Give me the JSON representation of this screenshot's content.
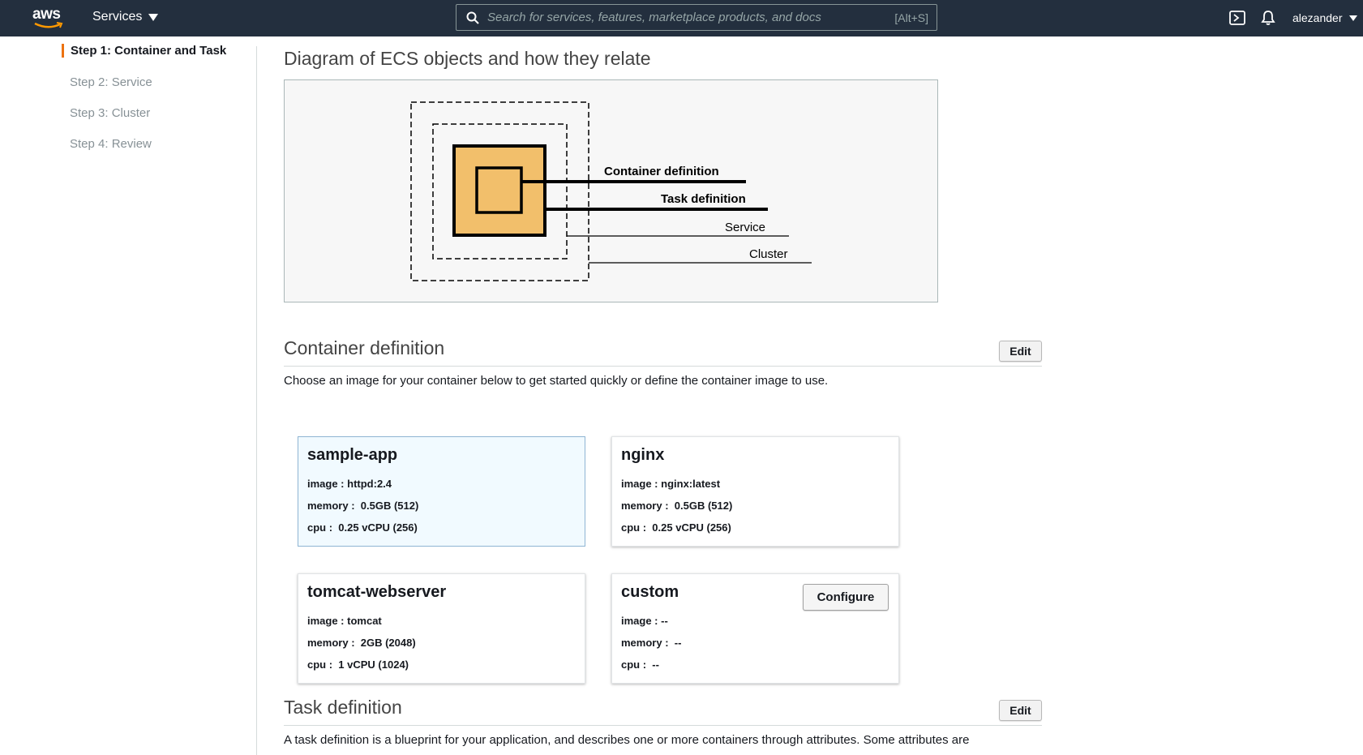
{
  "topnav": {
    "logo_text": "aws",
    "services_label": "Services",
    "search_placeholder": "Search for services, features, marketplace products, and docs",
    "search_shortcut": "[Alt+S]",
    "username": "alezander"
  },
  "steps": [
    {
      "label": "Step 1: Container and Task",
      "active": true
    },
    {
      "label": "Step 2: Service",
      "active": false
    },
    {
      "label": "Step 3: Cluster",
      "active": false
    },
    {
      "label": "Step 4: Review",
      "active": false
    }
  ],
  "diagram": {
    "heading": "Diagram of ECS objects and how they relate",
    "labels": {
      "container_definition": "Container definition",
      "task_definition": "Task definition",
      "service": "Service",
      "cluster": "Cluster"
    },
    "colors": {
      "fill": "#f2bf6b",
      "background": "#f7f7f7"
    }
  },
  "container_section": {
    "heading": "Container definition",
    "edit_label": "Edit",
    "description": "Choose an image for your container below to get started quickly or define the container image to use.",
    "cards": [
      {
        "title": "sample-app",
        "image_label": "image :",
        "image": "httpd:2.4",
        "memory_label": "memory :",
        "memory": "0.5GB (512)",
        "cpu_label": "cpu :",
        "cpu": "0.25 vCPU (256)",
        "selected": true
      },
      {
        "title": "nginx",
        "image_label": "image :",
        "image": "nginx:latest",
        "memory_label": "memory :",
        "memory": "0.5GB (512)",
        "cpu_label": "cpu :",
        "cpu": "0.25 vCPU (256)",
        "selected": false
      },
      {
        "title": "tomcat-webserver",
        "image_label": "image :",
        "image": "tomcat",
        "memory_label": "memory :",
        "memory": "2GB (2048)",
        "cpu_label": "cpu :",
        "cpu": "1 vCPU (1024)",
        "selected": false
      },
      {
        "title": "custom",
        "image_label": "image :",
        "image": "--",
        "memory_label": "memory :",
        "memory": "--",
        "cpu_label": "cpu :",
        "cpu": "--",
        "selected": false,
        "configure_label": "Configure"
      }
    ]
  },
  "task_section": {
    "heading": "Task definition",
    "edit_label": "Edit",
    "description": "A task definition is a blueprint for your application, and describes one or more containers through attributes. Some attributes are"
  },
  "colors": {
    "nav_bg": "#232f3e",
    "accent": "#ec7211",
    "selected_card_bg": "#f1faff"
  }
}
